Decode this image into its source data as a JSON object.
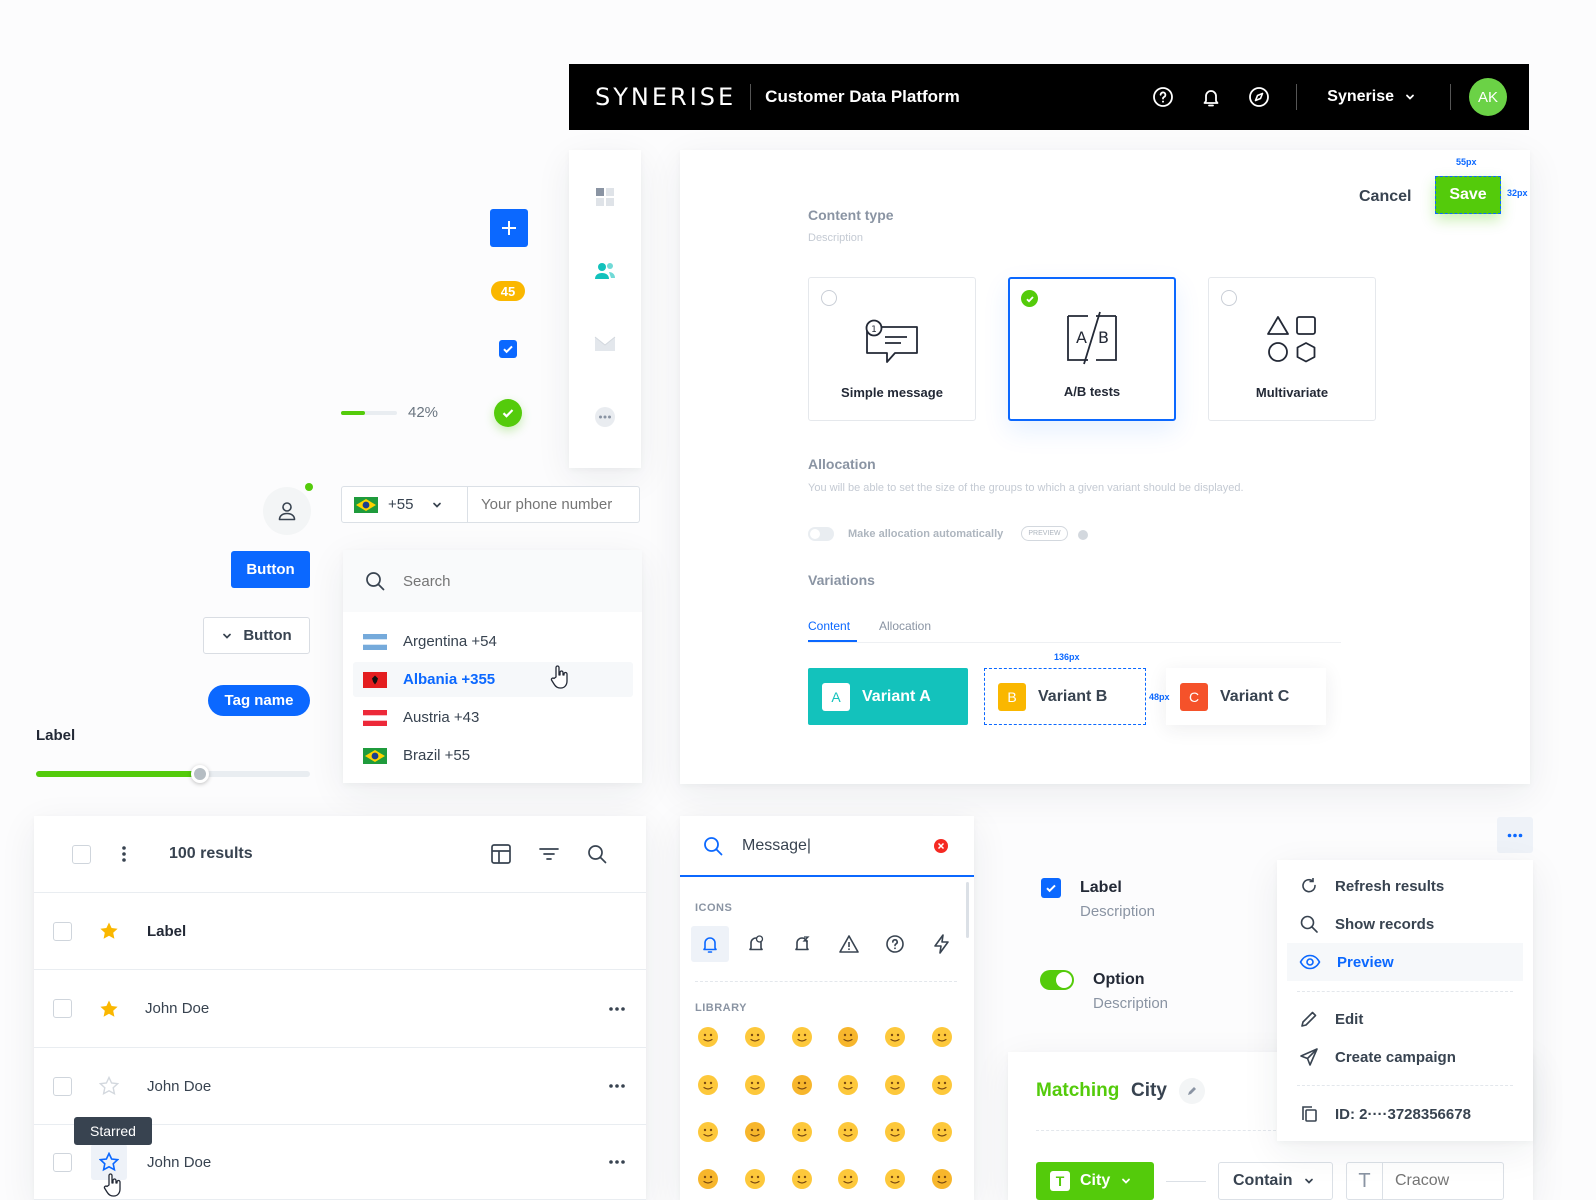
{
  "topbar": {
    "logo": "SYNERISE",
    "app_title": "Customer Data Platform",
    "org": "Synerise",
    "avatar_initials": "AK",
    "avatar_color": "#6bd246"
  },
  "widgets": {
    "badge_count": "45",
    "progress_value": 0.42,
    "progress_label": "42%",
    "button_label": "Button",
    "dropdown_button_label": "Button",
    "tag_label": "Tag name",
    "slider_label": "Label",
    "slider_value": 0.6
  },
  "phone": {
    "code": "+55",
    "placeholder": "Your phone number",
    "search_placeholder": "Search",
    "countries": [
      "Argentina +54",
      "Albania +355",
      "Austria +43",
      "Brazil +55"
    ]
  },
  "content_panel": {
    "cancel": "Cancel",
    "save": "Save",
    "save_width_annotation": "55px",
    "save_height_annotation": "32px",
    "content_type_label": "Content type",
    "content_type_desc": "Description",
    "types": [
      "Simple message",
      "A/B tests",
      "Multivariate"
    ],
    "selected_type": "A/B tests",
    "allocation_title": "Allocation",
    "allocation_desc": "You will be able to set the size of the groups to which a given variant should be displayed.",
    "allocation_toggle": "Make allocation automatically",
    "preview_badge": "PREVIEW",
    "variations_title": "Variations",
    "tabs": [
      "Content",
      "Allocation"
    ],
    "variants": [
      {
        "letter": "A",
        "name": "Variant A",
        "color": "#13c2bc"
      },
      {
        "letter": "B",
        "name": "Variant B",
        "color": "#fab700"
      },
      {
        "letter": "C",
        "name": "Variant C",
        "color": "#f5522a"
      }
    ],
    "variant_width_annotation": "136px",
    "variant_height_annotation": "48px"
  },
  "table": {
    "results": "100 results",
    "header_label": "Label",
    "rows": [
      "John Doe",
      "John Doe",
      "John Doe"
    ],
    "tooltip": "Starred"
  },
  "picker": {
    "search_value": "Message|",
    "icons_section": "ICONS",
    "library_section": "LIBRARY"
  },
  "form": {
    "checkbox_label": "Label",
    "checkbox_desc": "Description",
    "toggle_label": "Option",
    "toggle_desc": "Description"
  },
  "menu": {
    "items": [
      "Refresh results",
      "Show records",
      "Preview",
      "Edit",
      "Create campaign"
    ],
    "id": "ID: 2····3728356678"
  },
  "matching": {
    "matching": "Matching",
    "city": "City",
    "field": "City",
    "operator": "Contain",
    "value_placeholder": "Cracow"
  },
  "colors": {
    "primary": "#0b68ff",
    "green": "#54cb0b",
    "teal": "#13c2bc",
    "yellow": "#fab700",
    "red": "#f5522a"
  }
}
